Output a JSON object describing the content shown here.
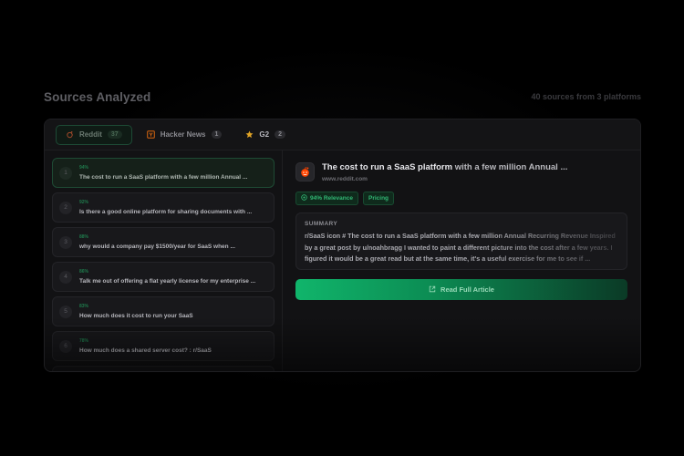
{
  "header": {
    "title": "Sources Analyzed",
    "sources_count": "40 sources from 3 platforms"
  },
  "tabs": [
    {
      "label": "Reddit",
      "count": "37",
      "icon": "reddit-icon",
      "active": true
    },
    {
      "label": "Hacker News",
      "count": "1",
      "icon": "hacker-news-icon",
      "active": false
    },
    {
      "label": "G2",
      "count": "2",
      "icon": "star-icon",
      "active": false
    }
  ],
  "list": [
    {
      "num": "1",
      "relevance": "94%",
      "title": "The cost to run a SaaS platform with a few million Annual ..."
    },
    {
      "num": "2",
      "relevance": "92%",
      "title": "Is there a good online platform for sharing documents with ..."
    },
    {
      "num": "3",
      "relevance": "88%",
      "title": "why would a company pay $1500/year for SaaS when ..."
    },
    {
      "num": "4",
      "relevance": "86%",
      "title": "Talk me out of offering a flat yearly license for my enterprise ..."
    },
    {
      "num": "5",
      "relevance": "83%",
      "title": "How much does it cost to run your SaaS"
    },
    {
      "num": "6",
      "relevance": "78%",
      "title": "How much does a shared server cost? : r/SaaS"
    }
  ],
  "detail": {
    "title_main": "The cost to run a SaaS platform",
    "title_rest": " with a few million Annual ...",
    "url": "www.reddit.com",
    "relevance_tag": "94% Relevance",
    "category_tag": "Pricing",
    "summary_label": "SUMMARY",
    "summary_text": "r/SaaS icon # The cost to run a SaaS platform with a few million Annual Recurring Revenue Inspired by a great post by u/noahbragg I wanted to paint a different picture into the cost after a few years. I figured it would be a great read but at the same time, it's a useful exercise for me to see if ...",
    "read_button": "Read Full Article"
  },
  "colors": {
    "accent": "#10b56b",
    "background": "#000000",
    "panel": "#121214"
  }
}
